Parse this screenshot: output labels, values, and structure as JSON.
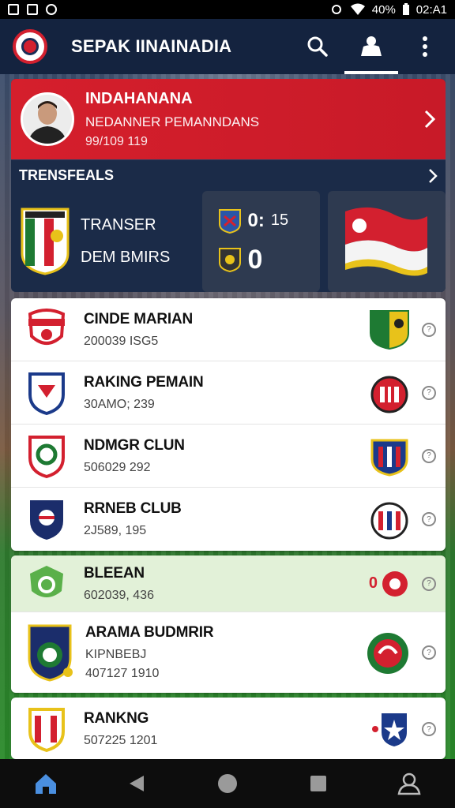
{
  "status_bar": {
    "battery": "40%",
    "time": "02:A1"
  },
  "app": {
    "title": "SEPAK IINAINADIA"
  },
  "player_card": {
    "name": "INDAHANANA",
    "subtitle": "NEDANNER PEMANNDANS",
    "numbers": "99/109 119"
  },
  "transfers": {
    "heading": "TRENSFEALS",
    "line1": "TRANSER",
    "line2": "DEM BMIRS",
    "score_top": "0:",
    "score_top_extra": "15",
    "score_bottom": "0"
  },
  "list1": [
    {
      "title": "CINDE MARIAN",
      "sub": "200039 ISG5"
    },
    {
      "title": "RAKING PEMAIN",
      "sub": "30AMO; 239"
    },
    {
      "title": "NDMGR CLUN",
      "sub": "506029 292"
    },
    {
      "title": "RRNEB CLUB",
      "sub": "2J589, 195"
    }
  ],
  "list2": [
    {
      "title": "BLEEAN",
      "sub": "602039, 436",
      "badge_prefix": "0"
    },
    {
      "title": "ARAMA BUDMRIR",
      "sub": "KIPNBEBJ",
      "sub2": "407127 1910"
    }
  ],
  "list3": [
    {
      "title": "RANKNG",
      "sub": "507225 1201"
    }
  ],
  "icons": {
    "accent_red": "#d51f2c",
    "navy": "#14233f",
    "highlight_green": "#e2f1d8"
  }
}
